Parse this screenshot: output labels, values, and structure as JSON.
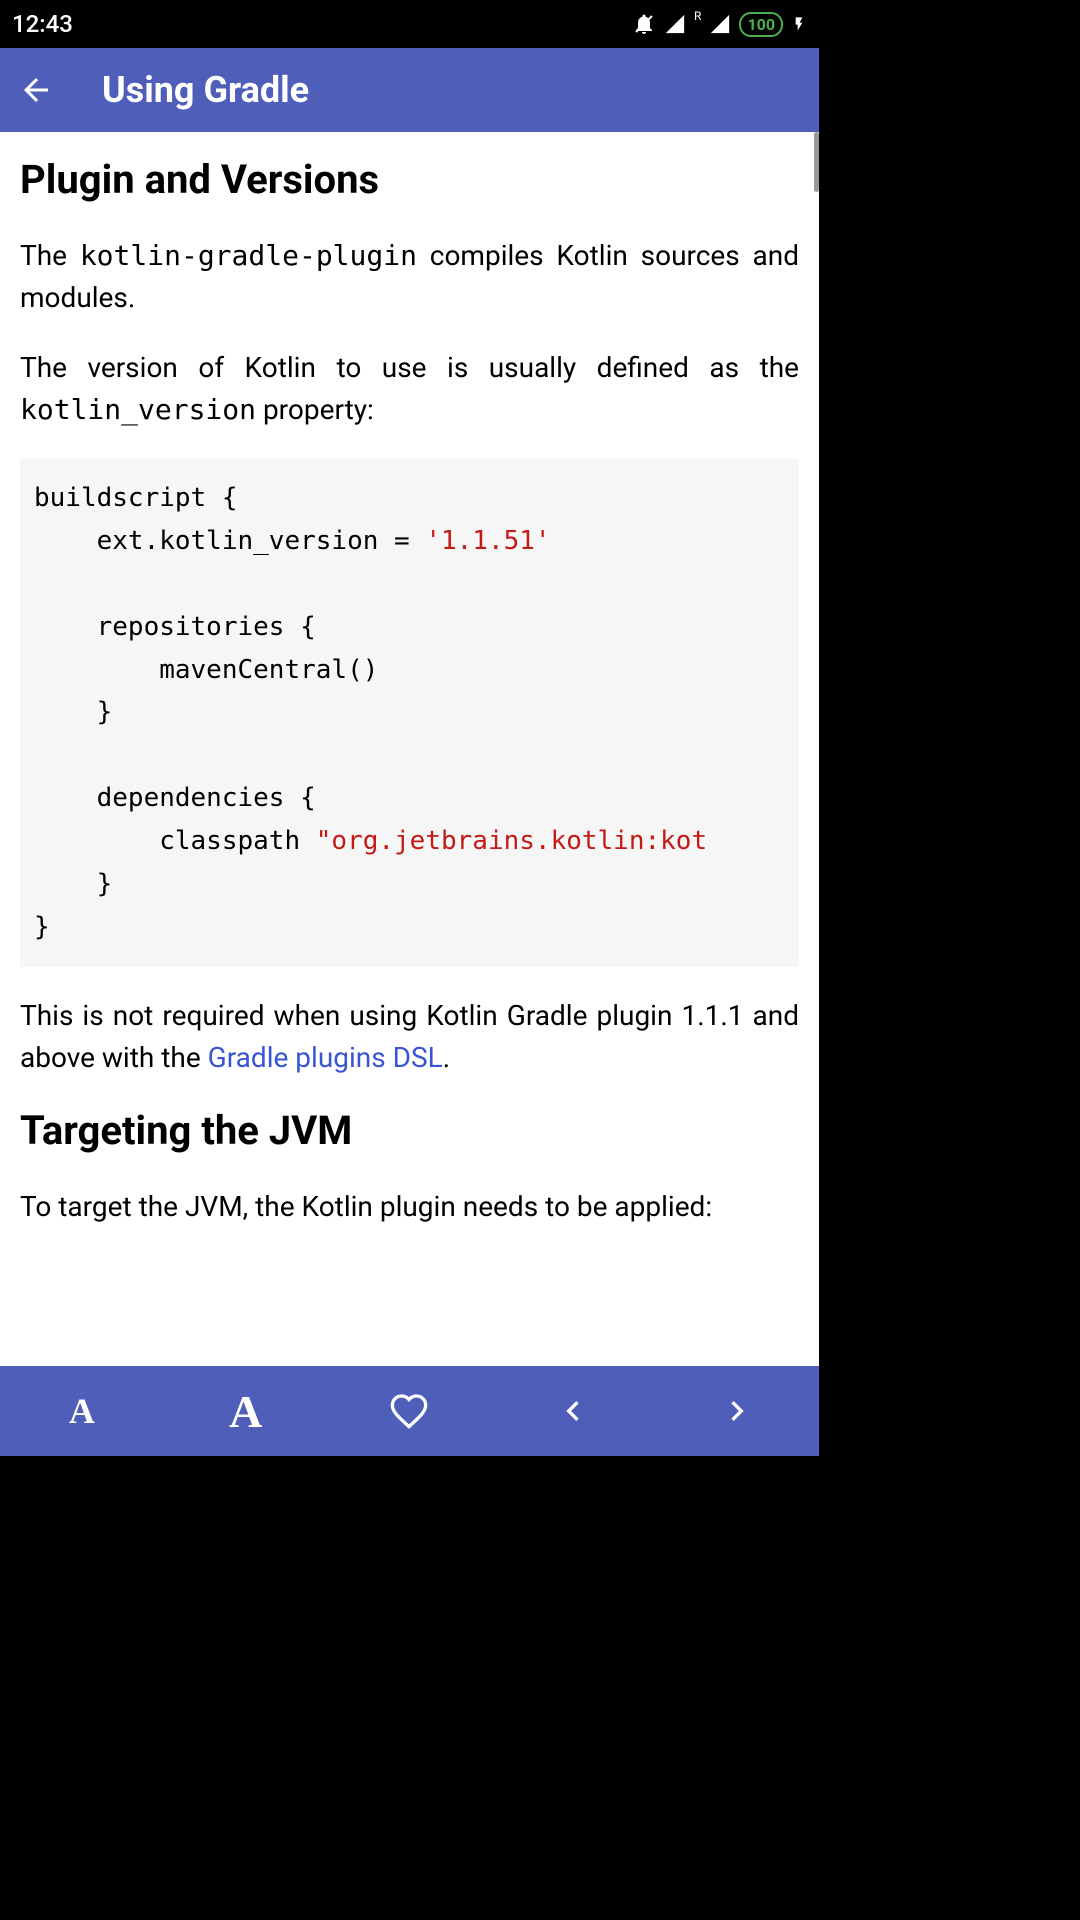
{
  "status": {
    "time": "12:43",
    "battery": "100"
  },
  "appbar": {
    "title": "Using Gradle"
  },
  "content": {
    "heading1": "Plugin and Versions",
    "para1_part1": "The ",
    "para1_code": "kotlin-gradle-plugin",
    "para1_part2": " compiles Kotlin sources and modules.",
    "para2_part1": "The version of Kotlin to use is usually defined as the ",
    "para2_code": "kotlin_version",
    "para2_part2": " property:",
    "code1_line1": "buildscript {",
    "code1_line2a": "    ext.kotlin_version = ",
    "code1_line2b": "'1.1.51'",
    "code1_line3": "",
    "code1_line4": "    repositories {",
    "code1_line5": "        mavenCentral()",
    "code1_line6": "    }",
    "code1_line7": "",
    "code1_line8": "    dependencies {",
    "code1_line9a": "        classpath ",
    "code1_line9b": "\"org.jetbrains.kotlin:kot",
    "code1_line10": "    }",
    "code1_line11": "}",
    "para3_part1": "This is not required when using Kotlin Gradle plugin 1.1.1 and above with the ",
    "para3_link": "Gradle plugins DSL",
    "para3_part2": ".",
    "heading2": "Targeting the JVM",
    "para4": "To target the JVM, the Kotlin plugin needs to be applied:"
  }
}
